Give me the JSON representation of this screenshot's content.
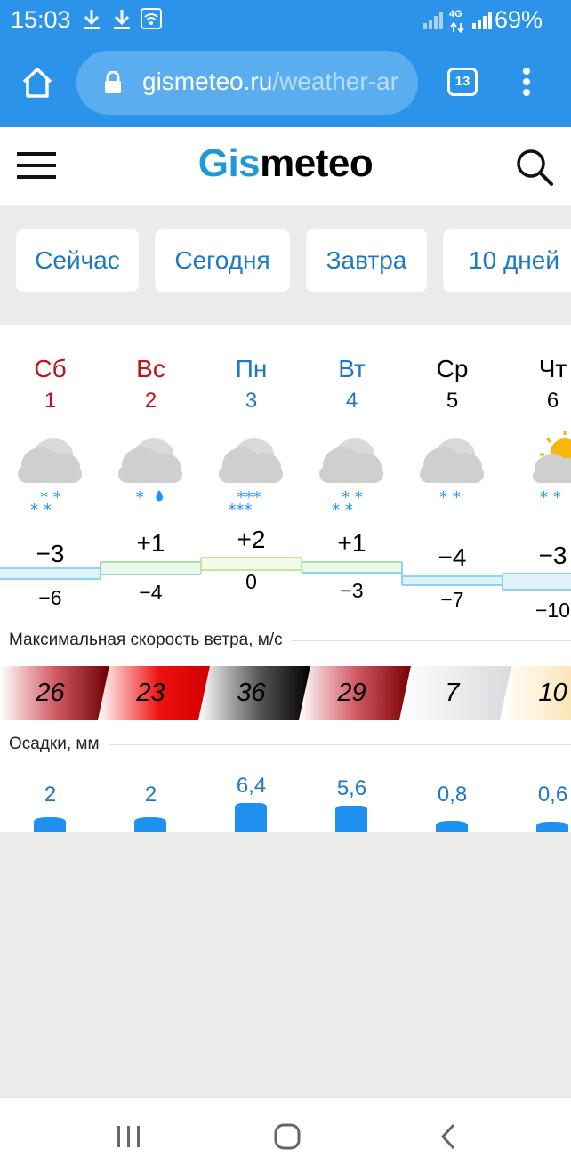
{
  "status": {
    "time": "15:03",
    "battery": "69%",
    "network": "4G"
  },
  "browser": {
    "url_domain": "gismeteo.ru",
    "url_path": "/weather-ar",
    "tab_count": "13"
  },
  "site": {
    "logo_part1": "Gis",
    "logo_part2": "meteo"
  },
  "nav": {
    "now": "Сейчас",
    "today": "Сегодня",
    "tomorrow": "Завтра",
    "ten_days": "10 дней"
  },
  "days": [
    {
      "name": "Сб",
      "num": "1",
      "max": "−3",
      "min": "−6",
      "wind": "26",
      "precip": "2",
      "icon": "cloud-snow-icon"
    },
    {
      "name": "Вс",
      "num": "2",
      "max": "+1",
      "min": "−4",
      "wind": "23",
      "precip": "2",
      "icon": "cloud-snow-rain-icon"
    },
    {
      "name": "Пн",
      "num": "3",
      "max": "+2",
      "min": "0",
      "wind": "36",
      "precip": "6,4",
      "icon": "cloud-heavy-snow-icon"
    },
    {
      "name": "Вт",
      "num": "4",
      "max": "+1",
      "min": "−3",
      "wind": "29",
      "precip": "5,6",
      "icon": "cloud-snow-icon"
    },
    {
      "name": "Ср",
      "num": "5",
      "max": "−4",
      "min": "−7",
      "wind": "7",
      "precip": "0,8",
      "icon": "cloud-light-snow-icon"
    },
    {
      "name": "Чт",
      "num": "6",
      "max": "−3",
      "min": "−10",
      "wind": "10",
      "precip": "0,6",
      "icon": "sun-cloud-snow-icon"
    }
  ],
  "sections": {
    "wind_title": "Максимальная скорость ветра, м/с",
    "precip_title": "Осадки, мм"
  },
  "colors": {
    "browser_bar": "#2b94ea",
    "accent_blue": "#1e78c8",
    "weekend_red": "#c0111c",
    "precip_bar": "#1e90f0"
  }
}
